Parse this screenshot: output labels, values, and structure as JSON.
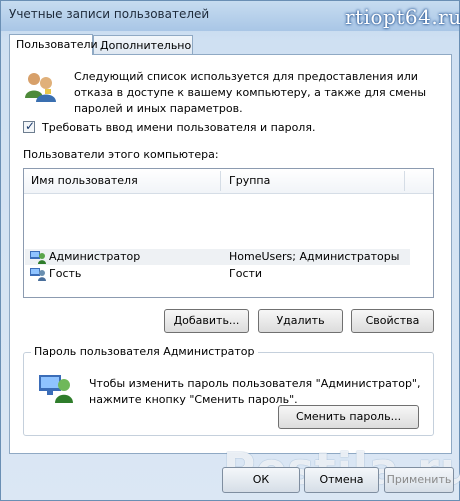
{
  "window": {
    "title": "Учетные записи пользователей"
  },
  "watermark_top": "rtiopt64.ru",
  "watermark_bottom": "Postila.ru",
  "tabs": [
    {
      "label": "Пользователи",
      "active": true
    },
    {
      "label": "Дополнительно",
      "active": false
    }
  ],
  "intro": {
    "text": "Следующий список используется для предоставления или отказа в доступе к вашему компьютеру, а также для смены паролей и иных параметров."
  },
  "require_login": {
    "label": "Требовать ввод имени пользователя и пароля.",
    "checked": true
  },
  "users": {
    "title": "Пользователи этого компьютера:",
    "columns": [
      "Имя пользователя",
      "Группа"
    ],
    "rows": [
      {
        "name": "Администратор",
        "group": "HomeUsers; Администраторы",
        "selected": true,
        "icon": "user-icon"
      },
      {
        "name": "Гость",
        "group": "Гости",
        "selected": false,
        "icon": "user-icon"
      }
    ]
  },
  "buttons": {
    "add": "Добавить...",
    "remove": "Удалить",
    "properties": "Свойства"
  },
  "password_group": {
    "title": "Пароль пользователя Администратор",
    "line1": "Чтобы изменить пароль пользователя \"Администратор\",",
    "line2": "нажмите кнопку \"Сменить пароль\".",
    "change_button": "Сменить пароль..."
  },
  "footer": {
    "ok": "ОК",
    "cancel": "Отмена",
    "apply": "Применить"
  },
  "colors": {
    "selection": "#eef1f4",
    "border": "#8fa9c4"
  }
}
